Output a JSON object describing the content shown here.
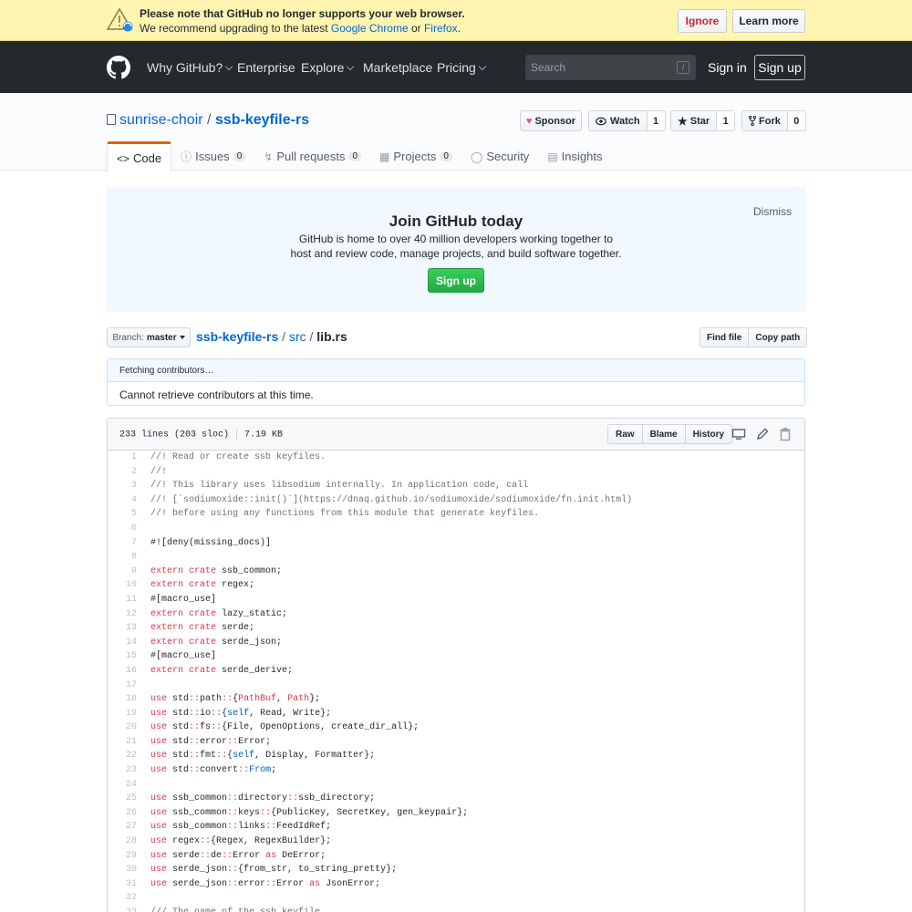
{
  "notice": {
    "line1": "Please note that GitHub no longer supports your web browser.",
    "line2_prefix": "We recommend upgrading to the latest ",
    "chrome": "Google Chrome",
    "or": " or ",
    "firefox": "Firefox",
    "period": ".",
    "ignore": "Ignore",
    "learn_more": "Learn more"
  },
  "header": {
    "nav": [
      "Why GitHub?",
      "Enterprise",
      "Explore",
      "Marketplace",
      "Pricing"
    ],
    "search_placeholder": "Search",
    "search_key": "/",
    "sign_in": "Sign in",
    "sign_up": "Sign up"
  },
  "repo": {
    "owner": "sunrise-choir",
    "slash": " / ",
    "name": "ssb-keyfile-rs",
    "sponsor": "Sponsor",
    "watch": "Watch",
    "watch_count": "1",
    "star": "Star",
    "star_count": "1",
    "fork": "Fork",
    "fork_count": "0"
  },
  "tabs": [
    {
      "label": "Code",
      "icon": "<>"
    },
    {
      "label": "Issues",
      "count": "0"
    },
    {
      "label": "Pull requests",
      "count": "0"
    },
    {
      "label": "Projects",
      "count": "0"
    },
    {
      "label": "Security"
    },
    {
      "label": "Insights"
    }
  ],
  "join": {
    "title": "Join GitHub today",
    "desc": "GitHub is home to over 40 million developers working together to host and review code, manage projects, and build software together.",
    "sign_up": "Sign up",
    "dismiss": "Dismiss"
  },
  "filenav": {
    "branch_label": "Branch:",
    "branch": "master",
    "repo": "ssb-keyfile-rs",
    "dir": "src",
    "file": "lib.rs",
    "sep": " / ",
    "find_file": "Find file",
    "copy_path": "Copy path"
  },
  "contributors": {
    "fetching": "Fetching contributors…",
    "error": "Cannot retrieve contributors at this time."
  },
  "file": {
    "lines": "233 lines (203 sloc)",
    "size": "7.19 KB",
    "raw": "Raw",
    "blame": "Blame",
    "history": "History"
  },
  "code": [
    [
      [
        "c",
        "//! Read or create ssb keyfiles."
      ]
    ],
    [
      [
        "c",
        "//!"
      ]
    ],
    [
      [
        "c",
        "//! This library uses libsodium internally. In application code, call"
      ]
    ],
    [
      [
        "c",
        "//! [`sodiumoxide::init()`](https://dnaq.github.io/sodiumoxide/sodiumoxide/fn.init.html)"
      ]
    ],
    [
      [
        "c",
        "//! before using any functions from this module that generate keyfiles."
      ]
    ],
    [],
    [
      [
        "p",
        "#![deny(missing_docs)]"
      ]
    ],
    [],
    [
      [
        "k",
        "extern crate"
      ],
      [
        "p",
        " ssb_common;"
      ]
    ],
    [
      [
        "k",
        "extern crate"
      ],
      [
        "p",
        " regex;"
      ]
    ],
    [
      [
        "p",
        "#[macro_use]"
      ]
    ],
    [
      [
        "k",
        "extern crate"
      ],
      [
        "p",
        " lazy_static;"
      ]
    ],
    [
      [
        "k",
        "extern crate"
      ],
      [
        "p",
        " serde;"
      ]
    ],
    [
      [
        "k",
        "extern crate"
      ],
      [
        "p",
        " serde_json;"
      ]
    ],
    [
      [
        "p",
        "#[macro_use]"
      ]
    ],
    [
      [
        "k",
        "extern crate"
      ],
      [
        "p",
        " serde_derive;"
      ]
    ],
    [],
    [
      [
        "k",
        "use"
      ],
      [
        "p",
        " std"
      ],
      [
        "k",
        "::"
      ],
      [
        "p",
        "path"
      ],
      [
        "k",
        "::"
      ],
      [
        "p",
        "{"
      ],
      [
        "k",
        "PathBuf"
      ],
      [
        "p",
        ", "
      ],
      [
        "k",
        "Path"
      ],
      [
        "p",
        "};"
      ]
    ],
    [
      [
        "k",
        "use"
      ],
      [
        "p",
        " std"
      ],
      [
        "k",
        "::"
      ],
      [
        "p",
        "io"
      ],
      [
        "k",
        "::"
      ],
      [
        "p",
        "{"
      ],
      [
        "e",
        "self"
      ],
      [
        "p",
        ", Read, Write};"
      ]
    ],
    [
      [
        "k",
        "use"
      ],
      [
        "p",
        " std"
      ],
      [
        "k",
        "::"
      ],
      [
        "p",
        "fs"
      ],
      [
        "k",
        "::"
      ],
      [
        "p",
        "{File, OpenOptions, create_dir_all};"
      ]
    ],
    [
      [
        "k",
        "use"
      ],
      [
        "p",
        " std"
      ],
      [
        "k",
        "::"
      ],
      [
        "p",
        "error"
      ],
      [
        "k",
        "::"
      ],
      [
        "p",
        "Error;"
      ]
    ],
    [
      [
        "k",
        "use"
      ],
      [
        "p",
        " std"
      ],
      [
        "k",
        "::"
      ],
      [
        "p",
        "fmt"
      ],
      [
        "k",
        "::"
      ],
      [
        "p",
        "{"
      ],
      [
        "e",
        "self"
      ],
      [
        "p",
        ", Display, Formatter};"
      ]
    ],
    [
      [
        "k",
        "use"
      ],
      [
        "p",
        " std"
      ],
      [
        "k",
        "::"
      ],
      [
        "p",
        "convert"
      ],
      [
        "k",
        "::"
      ],
      [
        "e",
        "From"
      ],
      [
        "p",
        ";"
      ]
    ],
    [],
    [
      [
        "k",
        "use"
      ],
      [
        "p",
        " ssb_common"
      ],
      [
        "k",
        "::"
      ],
      [
        "p",
        "directory"
      ],
      [
        "k",
        "::"
      ],
      [
        "p",
        "ssb_directory;"
      ]
    ],
    [
      [
        "k",
        "use"
      ],
      [
        "p",
        " ssb_common"
      ],
      [
        "k",
        "::"
      ],
      [
        "p",
        "keys"
      ],
      [
        "k",
        "::"
      ],
      [
        "p",
        "{PublicKey, SecretKey, gen_keypair};"
      ]
    ],
    [
      [
        "k",
        "use"
      ],
      [
        "p",
        " ssb_common"
      ],
      [
        "k",
        "::"
      ],
      [
        "p",
        "links"
      ],
      [
        "k",
        "::"
      ],
      [
        "p",
        "FeedIdRef;"
      ]
    ],
    [
      [
        "k",
        "use"
      ],
      [
        "p",
        " regex"
      ],
      [
        "k",
        "::"
      ],
      [
        "p",
        "{Regex, RegexBuilder};"
      ]
    ],
    [
      [
        "k",
        "use"
      ],
      [
        "p",
        " serde"
      ],
      [
        "k",
        "::"
      ],
      [
        "p",
        "de"
      ],
      [
        "k",
        "::"
      ],
      [
        "p",
        "Error "
      ],
      [
        "k",
        "as"
      ],
      [
        "p",
        " DeError;"
      ]
    ],
    [
      [
        "k",
        "use"
      ],
      [
        "p",
        " serde_json"
      ],
      [
        "k",
        "::"
      ],
      [
        "p",
        "{from_str, to_string_pretty};"
      ]
    ],
    [
      [
        "k",
        "use"
      ],
      [
        "p",
        " serde_json"
      ],
      [
        "k",
        "::"
      ],
      [
        "p",
        "error"
      ],
      [
        "k",
        "::"
      ],
      [
        "p",
        "Error "
      ],
      [
        "k",
        "as"
      ],
      [
        "p",
        " JsonError;"
      ]
    ],
    [],
    [
      [
        "c",
        "/// The name of the ssb keyfile."
      ]
    ]
  ]
}
